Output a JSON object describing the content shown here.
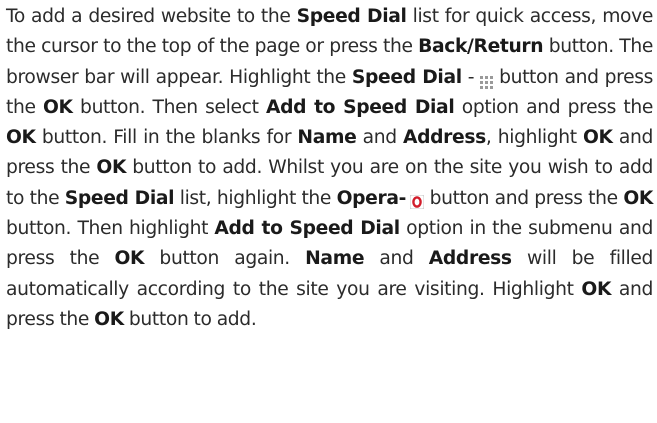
{
  "paragraph": {
    "s01": "To add a desired website to the ",
    "s02": "Speed Dial",
    "s03": " list for quick access, move the cursor to the top of the page or press the ",
    "s04": "Back/Return",
    "s05": " button. The browser bar will appear. Highlight the ",
    "s06": "Speed Dial",
    "s07": " - ",
    "s08": " button and press the ",
    "s09": "OK",
    "s10": " button. Then select ",
    "s11": "Add to Speed Dial",
    "s12": " option and press the ",
    "s13": "OK",
    "s14": " button. Fill in the blanks for ",
    "s15": "Name",
    "s16": " and ",
    "s17": "Address",
    "s18": ", highlight ",
    "s19": "OK",
    "s20": " and press the ",
    "s21": "OK",
    "s22": " button to add. Whilst you are on the site you wish to add to the ",
    "s23": "Speed Dial",
    "s24": " list, highlight the ",
    "s25": "Opera-",
    "s26": " button and press the ",
    "s27": "OK",
    "s28": " button. Then highlight ",
    "s29": "Add to Speed Dial",
    "s30": " option in the submenu and press the ",
    "s31": "OK",
    "s32": " button again. ",
    "s33": "Name",
    "s34": " and ",
    "s35": "Address",
    "s36": " will be filled automatically according to the site you are visiting. Highlight ",
    "s37": "OK",
    "s38": " and press the ",
    "s39": "OK",
    "s40": " button to add."
  },
  "icons": {
    "speed_dial": "speed-dial-grid-icon",
    "opera": "opera-logo-icon",
    "opera_color": "#d21d2b",
    "grid_color": "#9a9a9a"
  }
}
